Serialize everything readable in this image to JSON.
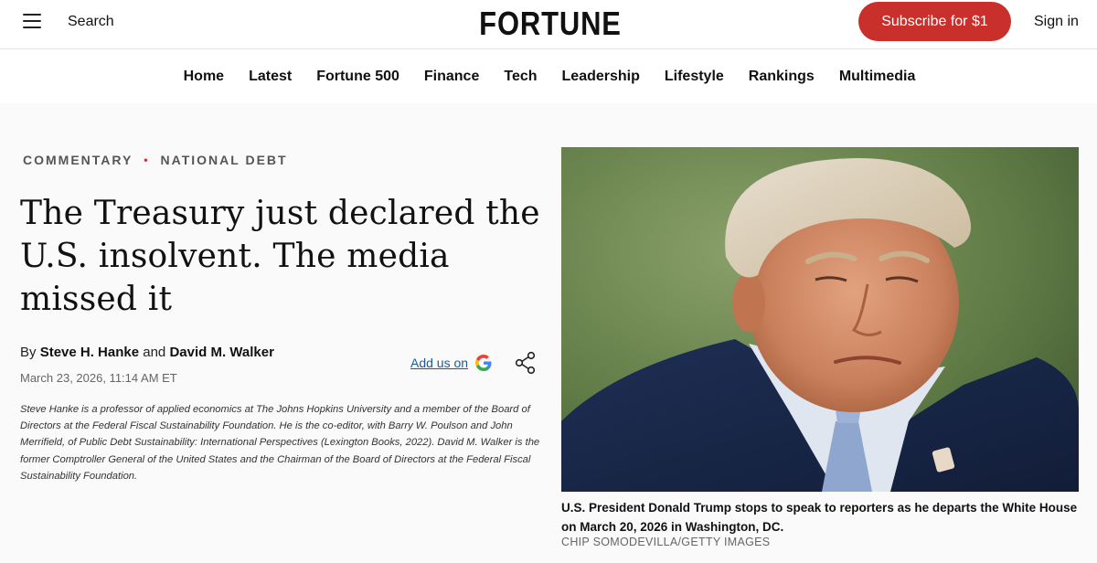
{
  "header": {
    "search_label": "Search",
    "logo_text": "FORTUNE",
    "subscribe_label": "Subscribe for $1",
    "signin_label": "Sign in",
    "brand_red": "#c9302c"
  },
  "nav": {
    "items": [
      "Home",
      "Latest",
      "Fortune 500",
      "Finance",
      "Tech",
      "Leadership",
      "Lifestyle",
      "Rankings",
      "Multimedia"
    ]
  },
  "article": {
    "section": "COMMENTARY",
    "topic": "NATIONAL DEBT",
    "headline": "The Treasury just declared the U.S. insolvent. The media missed it",
    "by_prefix": "By",
    "author1": "Steve H. Hanke",
    "and_text": "and",
    "author2": "David M. Walker",
    "date": "March 23, 2026, 11:14 AM ET",
    "add_us_label": "Add us on",
    "bio": "Steve Hanke is a professor of applied economics at The Johns Hopkins University and a member of the Board of Directors at the Federal Fiscal Sustainability Foundation. He is the co-editor, with Barry W. Poulson and John Merrifield, of Public Debt Sustainability: International Perspectives (Lexington Books, 2022). David M. Walker is the former Comptroller General of the United States and the Chairman of the Board of Directors at the Federal Fiscal Sustainability Foundation."
  },
  "image": {
    "caption": "U.S. President Donald Trump stops to speak to reporters as he departs the White House on March 20, 2026 in Washington, DC.",
    "credit": "CHIP SOMODEVILLA/GETTY IMAGES"
  },
  "icons": {
    "menu": "hamburger-menu-icon",
    "google": "google-g-icon",
    "share": "share-icon"
  }
}
